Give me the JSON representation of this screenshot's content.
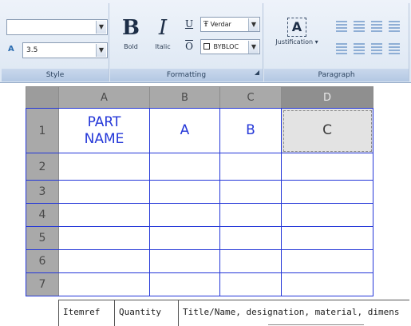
{
  "ribbon": {
    "style_panel": {
      "title": "Style",
      "style_combo_value": "",
      "size_value": "3.5"
    },
    "formatting_panel": {
      "title": "Formatting",
      "bold_label": "Bold",
      "italic_label": "Italic",
      "font_value": "Verdar",
      "color_value": "BYBLOC"
    },
    "paragraph_panel": {
      "title": "Paragraph",
      "justification_label": "Justification"
    }
  },
  "sheet": {
    "columns": [
      "A",
      "B",
      "C",
      "D"
    ],
    "rows": [
      "1",
      "2",
      "3",
      "4",
      "5",
      "6",
      "7"
    ],
    "row1": [
      "PART NAME",
      "A",
      "B",
      "C"
    ],
    "selected_cell": "D1"
  },
  "title_block": {
    "cells": [
      "Itemref",
      "Quantity",
      "Title/Name, designation, material, dimens"
    ]
  },
  "icons": {
    "font": "truetype-font-icon",
    "justification": "text-justification-icon"
  },
  "colors": {
    "grid_line": "#2437d8",
    "header_gray": "#a9a9a9",
    "ribbon_bg": "#dde7f3"
  }
}
